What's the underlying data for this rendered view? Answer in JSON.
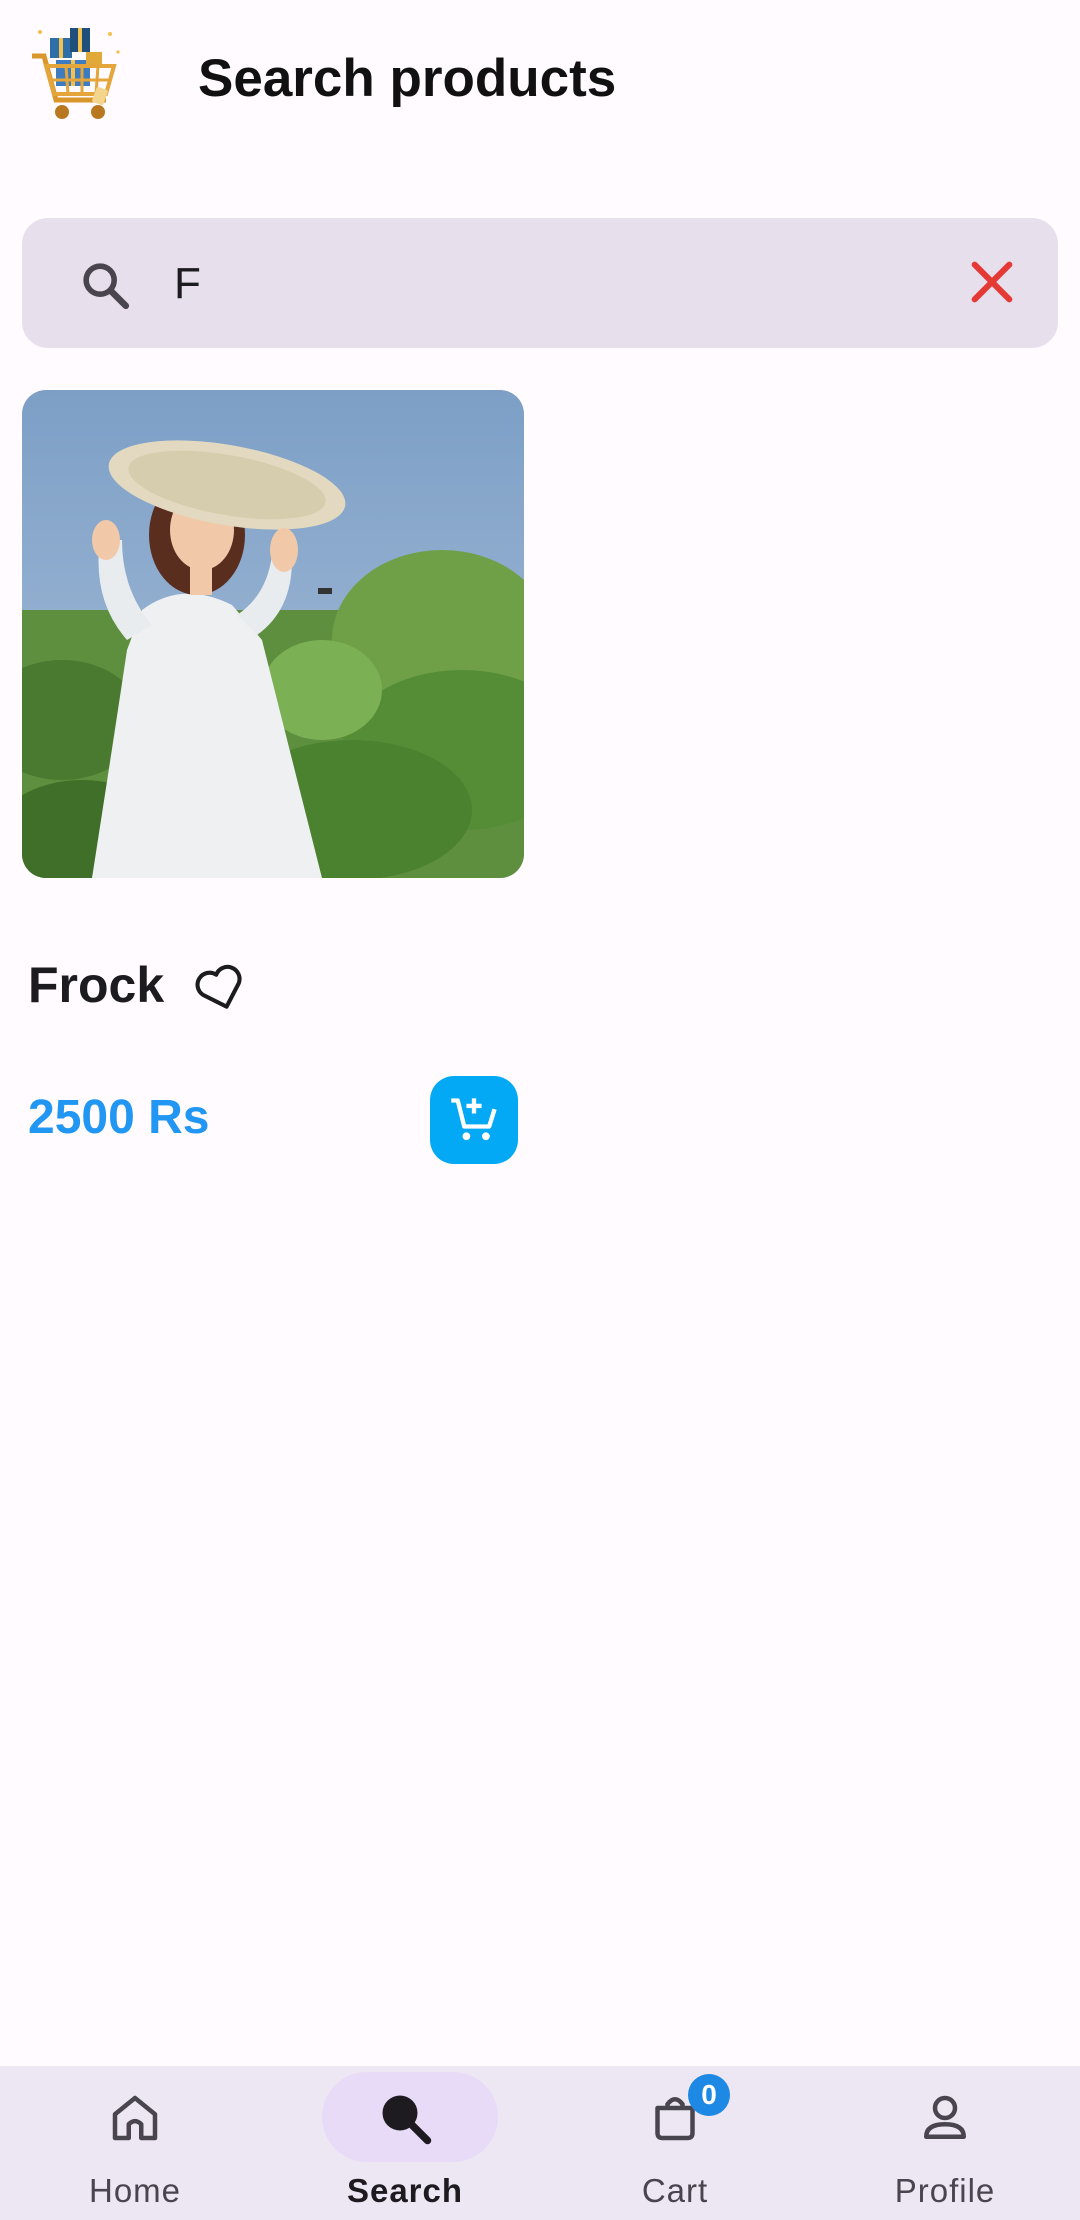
{
  "header": {
    "title": "Search products",
    "logo_icon": "shopping-cart-with-gifts-logo"
  },
  "search": {
    "value": "F",
    "search_icon": "search-icon",
    "clear_icon": "close-icon",
    "clear_color": "#e53935"
  },
  "products": [
    {
      "name": "Frock",
      "price": "2500 Rs",
      "favorite_icon": "heart-outline-icon",
      "cart_icon": "add-shopping-cart-icon"
    }
  ],
  "bottom_nav": {
    "items": [
      {
        "label": "Home",
        "icon": "home-icon"
      },
      {
        "label": "Search",
        "icon": "search-icon",
        "active": true
      },
      {
        "label": "Cart",
        "icon": "shopping-bag-icon",
        "badge": "0"
      },
      {
        "label": "Profile",
        "icon": "person-icon"
      }
    ]
  },
  "colors": {
    "accent": "#2196f3",
    "cart_button": "#03a9f4",
    "search_bg": "#e7e0ec",
    "nav_bg": "#ede6f3"
  }
}
